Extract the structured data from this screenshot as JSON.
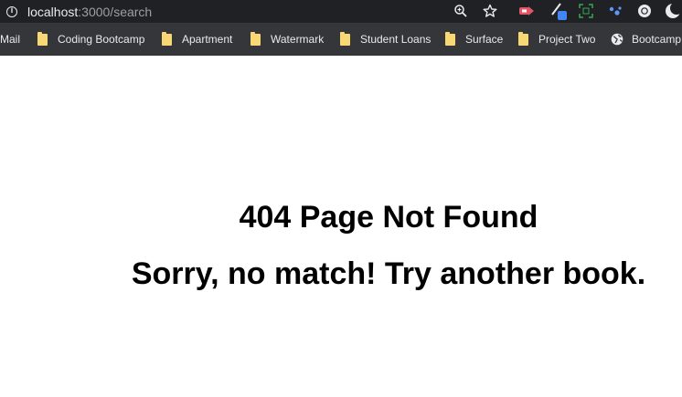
{
  "browser": {
    "url_host": "localhost",
    "url_rest": ":3000/search",
    "colors": {
      "bar": "#202124",
      "bookmarks_bar": "#35363a",
      "text": "#e8eaed",
      "folder": "#f8d775"
    },
    "toolbar_icons": [
      "zoom-icon",
      "star-icon",
      "extension-red-icon",
      "extension-pen-icon",
      "extension-screenshot-icon",
      "extension-paw-icon",
      "extension-circle-icon",
      "dark-mode-icon"
    ]
  },
  "bookmarks": [
    {
      "label": "Mail",
      "icon": "none"
    },
    {
      "label": "Coding Bootcamp",
      "icon": "folder-icon"
    },
    {
      "label": "Apartment",
      "icon": "folder-icon"
    },
    {
      "label": "Watermark",
      "icon": "folder-icon"
    },
    {
      "label": "Student Loans",
      "icon": "folder-icon"
    },
    {
      "label": "Surface",
      "icon": "folder-icon"
    },
    {
      "label": "Project Two",
      "icon": "folder-icon"
    },
    {
      "label": "Bootcamp",
      "icon": "globe-icon"
    }
  ],
  "page": {
    "title": "404 Page Not Found",
    "message": "Sorry, no match! Try another book."
  }
}
